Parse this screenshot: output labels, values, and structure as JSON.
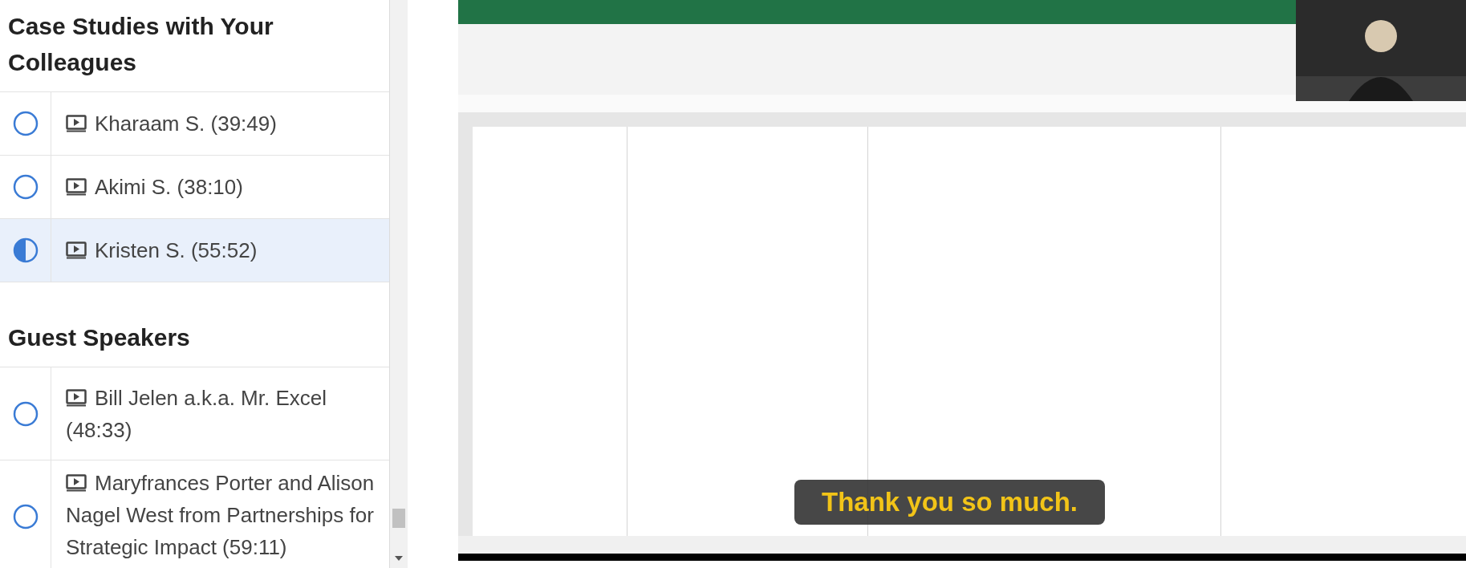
{
  "sections": [
    {
      "title": "Case Studies with Your Colleagues",
      "lessons": [
        {
          "title": "Kharaam S. (39:49)",
          "in_progress": false,
          "selected": false
        },
        {
          "title": "Akimi S. (38:10)",
          "in_progress": false,
          "selected": false
        },
        {
          "title": "Kristen S. (55:52)",
          "in_progress": true,
          "selected": true
        }
      ]
    },
    {
      "title": "Guest Speakers",
      "lessons": [
        {
          "title": "Bill Jelen a.k.a. Mr. Excel (48:33)",
          "in_progress": false,
          "selected": false
        },
        {
          "title": "Maryfrances Porter and Alison Nagel West from Partnerships for Strategic Impact (59:11)",
          "in_progress": false,
          "selected": false
        }
      ]
    }
  ],
  "video": {
    "kind": "picture",
    "caption": "Thank you so much."
  }
}
